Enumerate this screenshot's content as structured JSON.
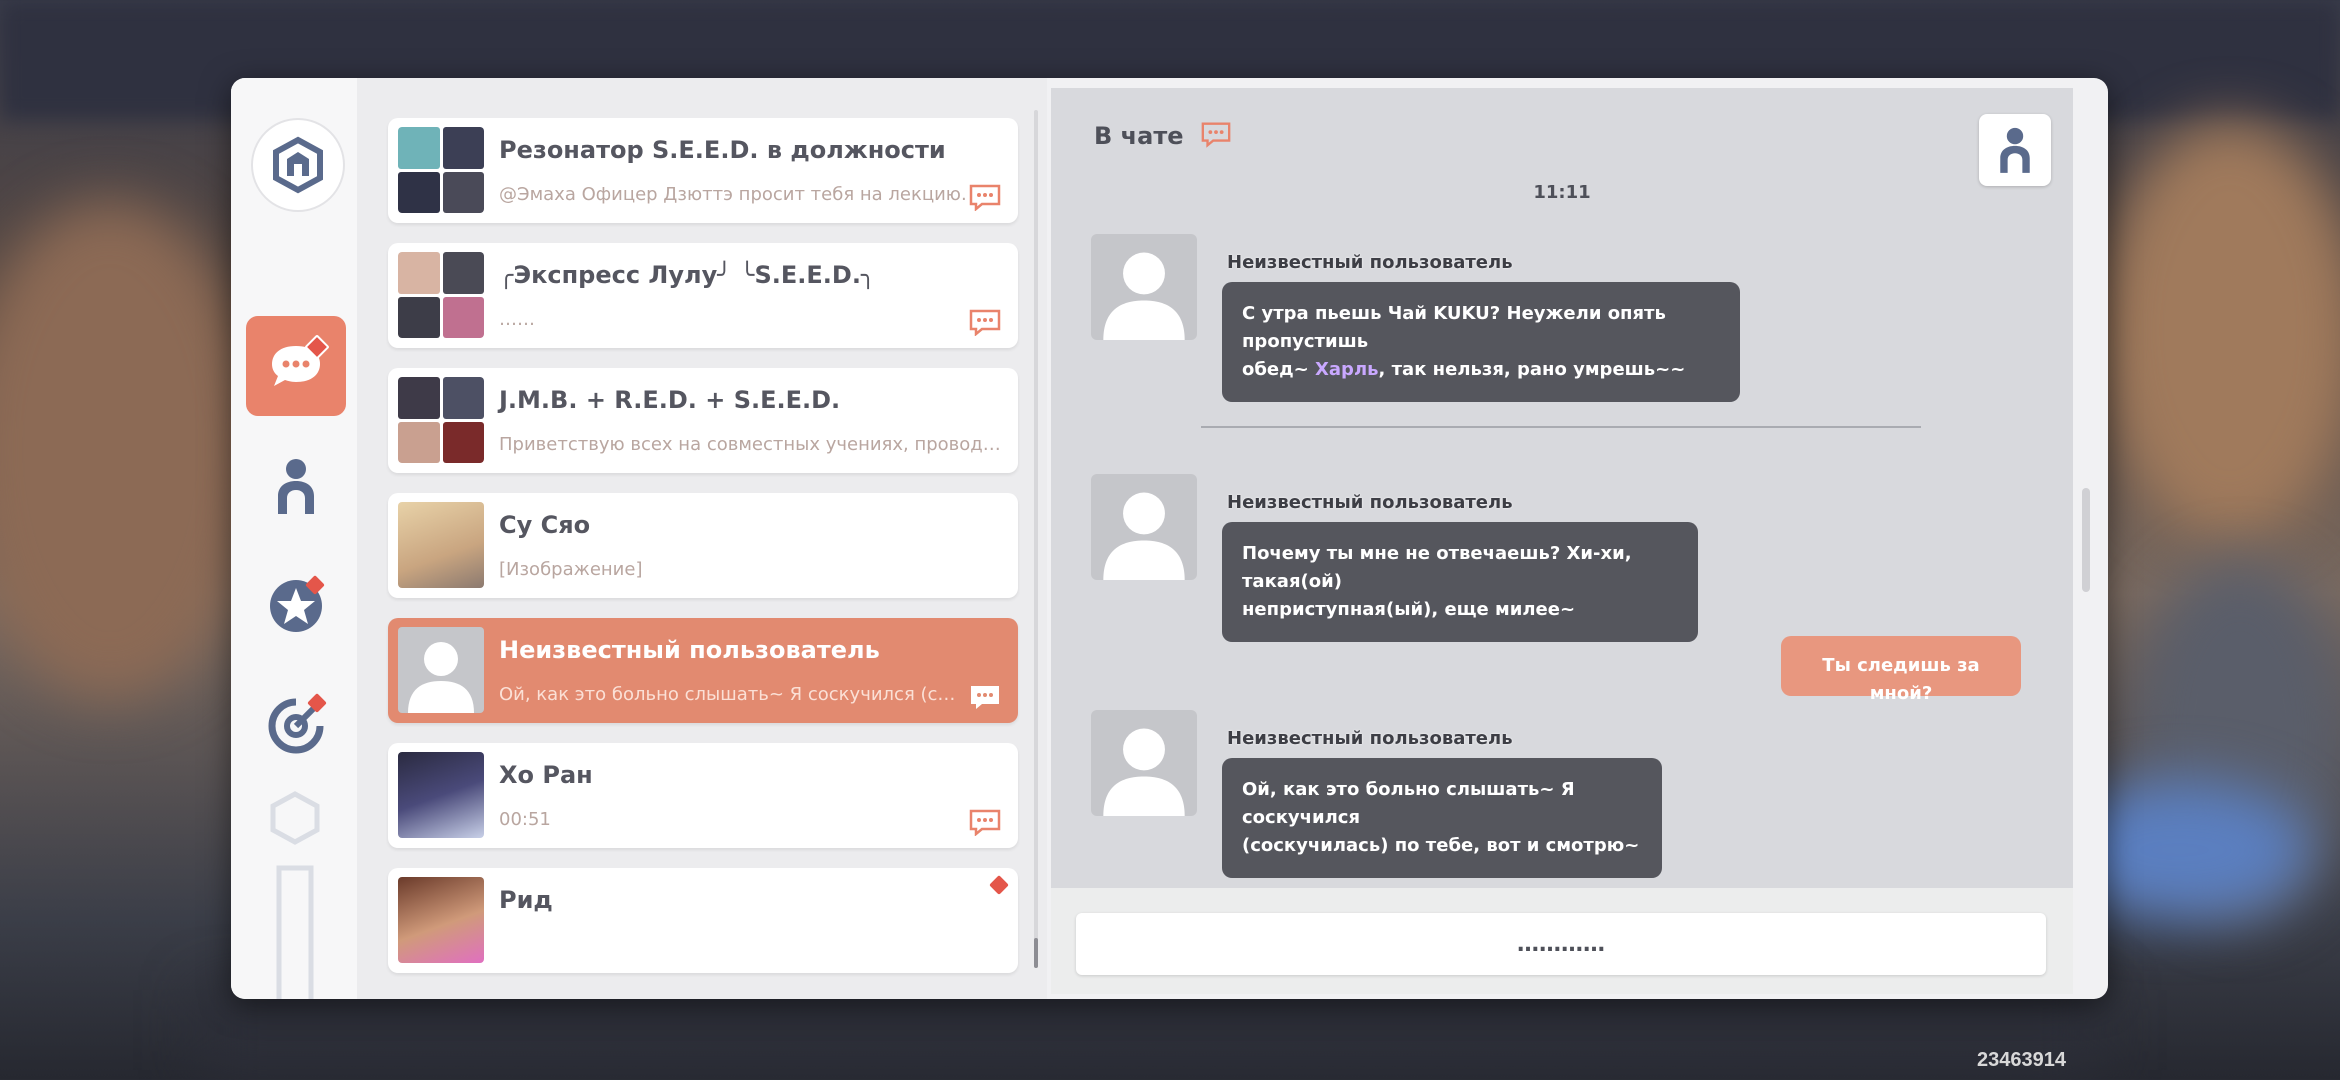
{
  "app": {
    "user_id": "23463914"
  },
  "sidebar": {
    "logo_icon": "home-hex-icon",
    "items": [
      {
        "name": "chat",
        "icon": "chat-bubble-icon",
        "active": true,
        "badge": true
      },
      {
        "name": "contacts",
        "icon": "person-icon",
        "active": false,
        "badge": false
      },
      {
        "name": "favorites",
        "icon": "star-icon",
        "active": false,
        "badge": true
      },
      {
        "name": "missions",
        "icon": "target-icon",
        "active": false,
        "badge": true
      }
    ]
  },
  "chat_list": [
    {
      "title": "Резонатор S.E.E.D. в должности",
      "subtitle": "@Эмаха Офицер Дзюттэ просит тебя на лекцию.",
      "group": true
    },
    {
      "title": "╭Экспресс Лулу╯ ╰S.E.E.D.╮",
      "subtitle": "……",
      "group": true
    },
    {
      "title": "J.M.B. + R.E.D. + S.E.E.D.",
      "subtitle": "Приветствую всех на совместных учениях, проводимых (…",
      "group": true
    },
    {
      "title": "Су Сяо",
      "subtitle": "[Изображение]",
      "group": false
    },
    {
      "title": "Неизвестный пользователь",
      "subtitle": "Ой, как это больно слышать~ Я соскучился (соскучи…",
      "group": false,
      "selected": true
    },
    {
      "title": "Хо Ран",
      "subtitle": "00:51",
      "group": false
    },
    {
      "title": "Рид",
      "subtitle": "",
      "group": false,
      "badge": true
    }
  ],
  "chat": {
    "title": "В чате",
    "time": "11:11",
    "messages": [
      {
        "sender": "Неизвестный пользователь",
        "line1": "С утра пьешь Чай KUKU? Неужели опять пропустишь",
        "line2_a": "обед~ ",
        "line2_hl": "Харль",
        "line2_b": ", так нельзя, рано умрешь~~"
      },
      {
        "sender": "Неизвестный пользователь",
        "line1": "Почему ты мне не отвечаешь? Хи-хи, такая(ой)",
        "line2": "неприступная(ый), еще милее~"
      },
      {
        "self": true,
        "text": "Ты следишь за мной?"
      },
      {
        "sender": "Неизвестный пользователь",
        "line1": "Ой, как это больно слышать~ Я соскучился",
        "line2": "(соскучилась) по тебе, вот и смотрю~"
      }
    ],
    "input_placeholder": "…………"
  },
  "colors": {
    "accent": "#e9836b",
    "bubble_dark": "#55565d",
    "bubble_self": "#e8977f",
    "highlight": "#c9a8ff"
  }
}
